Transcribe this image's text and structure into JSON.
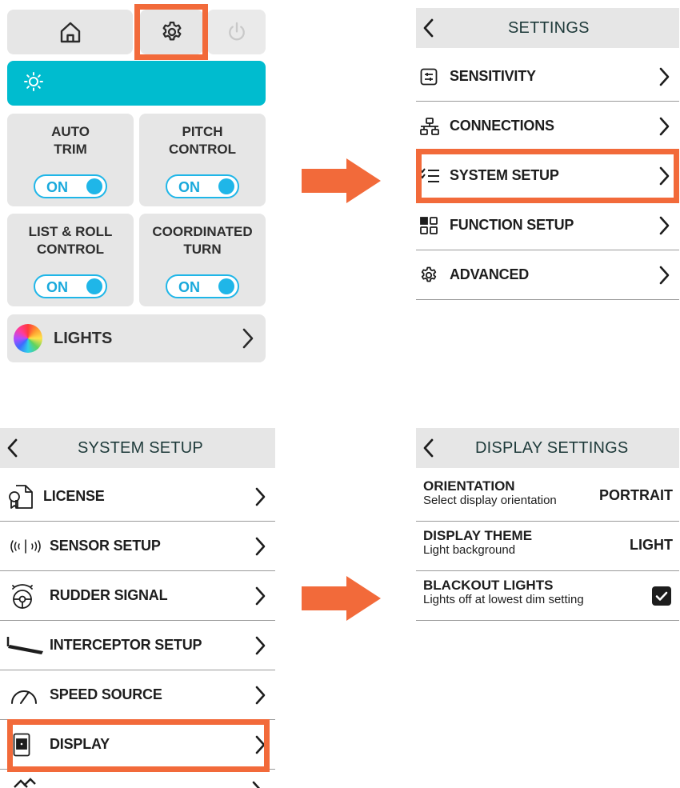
{
  "home_panel": {
    "top_buttons": [
      "home-icon",
      "gear-icon",
      "power-icon"
    ],
    "brightness_icon": "sun-icon",
    "tiles": [
      {
        "line1": "AUTO",
        "line2": "TRIM",
        "toggle": "ON"
      },
      {
        "line1": "PITCH",
        "line2": "CONTROL",
        "toggle": "ON"
      },
      {
        "line1": "LIST & ROLL",
        "line2": "CONTROL",
        "toggle": "ON"
      },
      {
        "line1": "COORDINATED",
        "line2": "TURN",
        "toggle": "ON"
      }
    ],
    "lights_label": "LIGHTS"
  },
  "settings_panel": {
    "title": "SETTINGS",
    "items": [
      {
        "label": "SENSITIVITY",
        "icon": "sliders-icon"
      },
      {
        "label": "CONNECTIONS",
        "icon": "network-icon"
      },
      {
        "label": "SYSTEM SETUP",
        "icon": "checklist-icon"
      },
      {
        "label": "FUNCTION SETUP",
        "icon": "grid-icon"
      },
      {
        "label": "ADVANCED",
        "icon": "gear-icon"
      }
    ]
  },
  "system_setup_panel": {
    "title": "SYSTEM SETUP",
    "items": [
      {
        "label": "LICENSE",
        "icon": "license-icon"
      },
      {
        "label": "SENSOR SETUP",
        "icon": "sensor-icon"
      },
      {
        "label": "RUDDER SIGNAL",
        "icon": "steering-wheel-icon"
      },
      {
        "label": "INTERCEPTOR SETUP",
        "icon": "interceptor-icon"
      },
      {
        "label": "SPEED SOURCE",
        "icon": "speedometer-icon"
      },
      {
        "label": "DISPLAY",
        "icon": "display-icon"
      }
    ]
  },
  "display_settings_panel": {
    "title": "DISPLAY SETTINGS",
    "items": [
      {
        "title": "ORIENTATION",
        "subtitle": "Select display orientation",
        "value": "PORTRAIT"
      },
      {
        "title": "DISPLAY THEME",
        "subtitle": "Light background",
        "value": "LIGHT"
      },
      {
        "title": "BLACKOUT LIGHTS",
        "subtitle": "Lights off at lowest dim setting",
        "checked": true
      }
    ]
  },
  "colors": {
    "accent": "#00bccf",
    "highlight": "#f26a3a",
    "toggle": "#1fb6e8",
    "panel_bg": "#e6e6e6"
  }
}
